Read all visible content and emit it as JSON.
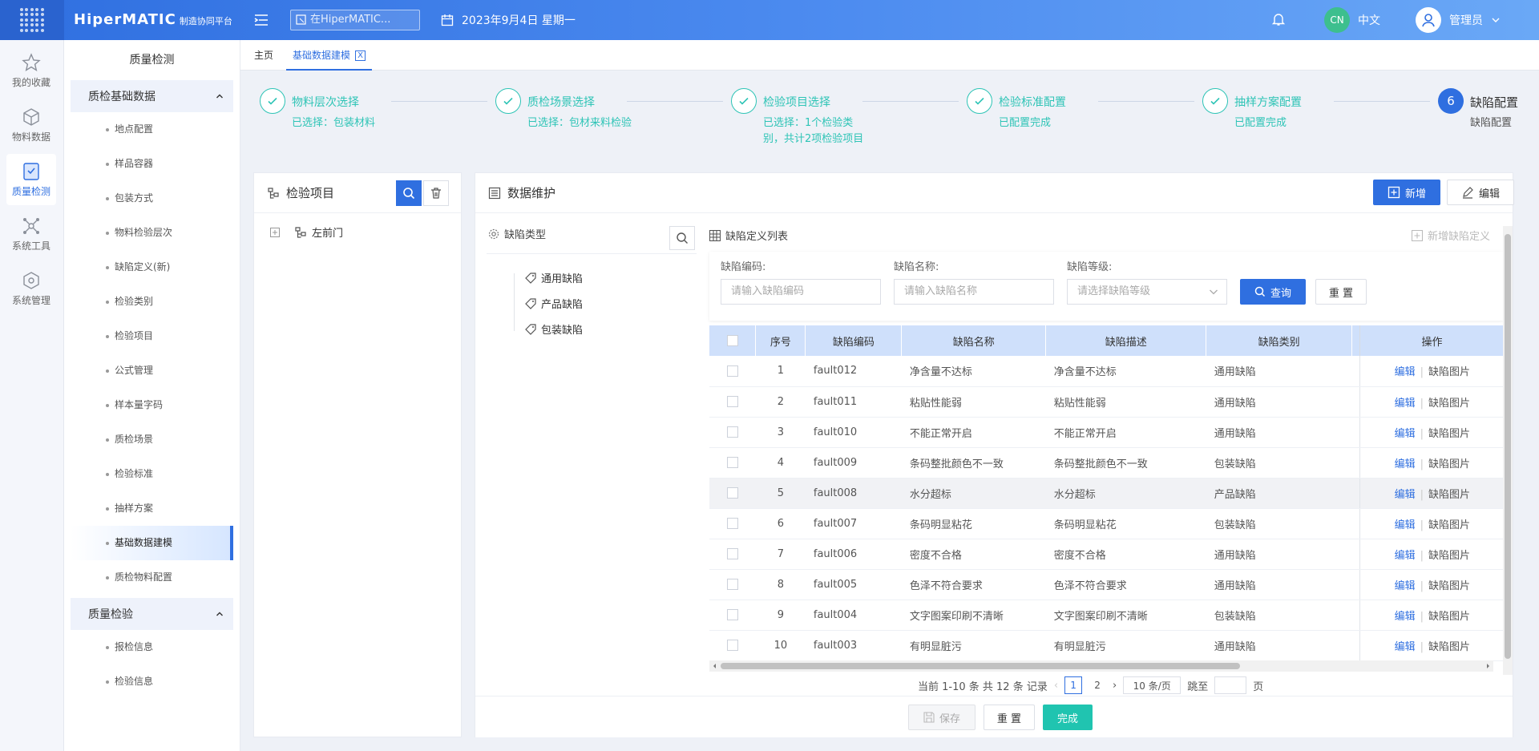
{
  "header": {
    "brand": "HiperMATIC",
    "brand_sub": "制造协同平台",
    "search_placeholder": "在HiperMATIC...",
    "date": "2023年9月4日 星期一",
    "lang_badge": "CN",
    "lang_label": "中文",
    "user_name": "管理员",
    "accent": "#2f6fe0"
  },
  "iconbar": {
    "items": [
      {
        "label": "我的收藏",
        "icon": "star-icon"
      },
      {
        "label": "物料数据",
        "icon": "cube-icon"
      },
      {
        "label": "质量检测",
        "icon": "shield-check-icon"
      },
      {
        "label": "系统工具",
        "icon": "network-icon"
      },
      {
        "label": "系统管理",
        "icon": "settings-cube-icon"
      }
    ]
  },
  "sidebar": {
    "title": "质量检测",
    "group1": "质检基础数据",
    "group1_items": [
      "地点配置",
      "样品容器",
      "包装方式",
      "物料检验层次",
      "缺陷定义(新)",
      "检验类别",
      "检验项目",
      "公式管理",
      "样本量字码",
      "质检场景",
      "检验标准",
      "抽样方案",
      "基础数据建模",
      "质检物料配置"
    ],
    "group2": "质量检验",
    "group2_items": [
      "报检信息",
      "检验信息"
    ]
  },
  "tabs": {
    "home": "主页",
    "active": "基础数据建模",
    "close": "X"
  },
  "steps": [
    {
      "title": "物料层次选择",
      "desc": "已选择：包装材料"
    },
    {
      "title": "质检场景选择",
      "desc": "已选择：包材来料检验"
    },
    {
      "title": "检验项目选择",
      "desc": "已选择：1个检验类别，共计2项检验项目"
    },
    {
      "title": "检验标准配置",
      "desc": "已配置完成"
    },
    {
      "title": "抽样方案配置",
      "desc": "已配置完成"
    },
    {
      "num": "6",
      "title": "缺陷配置",
      "desc": "缺陷配置"
    }
  ],
  "left_panel": {
    "title": "检验项目",
    "tree_node": "左前门"
  },
  "main_panel": {
    "title": "数据维护",
    "add_label": "新增",
    "edit_label": "编辑",
    "defect_type_title": "缺陷类型",
    "defect_types": [
      "通用缺陷",
      "产品缺陷",
      "包装缺陷"
    ],
    "list_title": "缺陷定义列表",
    "new_defect_label": "新增缺陷定义",
    "filters": {
      "code_label": "缺陷编码:",
      "code_placeholder": "请输入缺陷编码",
      "name_label": "缺陷名称:",
      "name_placeholder": "请输入缺陷名称",
      "level_label": "缺陷等级:",
      "level_placeholder": "请选择缺陷等级",
      "query_label": "查询",
      "reset_label": "重 置"
    },
    "columns": [
      "序号",
      "缺陷编码",
      "缺陷名称",
      "缺陷描述",
      "缺陷类别",
      "操作"
    ],
    "rows": [
      {
        "no": "1",
        "code": "fault012",
        "name": "净含量不达标",
        "desc": "净含量不达标",
        "cat": "通用缺陷"
      },
      {
        "no": "2",
        "code": "fault011",
        "name": "粘贴性能弱",
        "desc": "粘贴性能弱",
        "cat": "通用缺陷"
      },
      {
        "no": "3",
        "code": "fault010",
        "name": "不能正常开启",
        "desc": "不能正常开启",
        "cat": "通用缺陷"
      },
      {
        "no": "4",
        "code": "fault009",
        "name": "条码整批颜色不一致",
        "desc": "条码整批颜色不一致",
        "cat": "包装缺陷"
      },
      {
        "no": "5",
        "code": "fault008",
        "name": "水分超标",
        "desc": "水分超标",
        "cat": "产品缺陷"
      },
      {
        "no": "6",
        "code": "fault007",
        "name": "条码明显粘花",
        "desc": "条码明显粘花",
        "cat": "包装缺陷"
      },
      {
        "no": "7",
        "code": "fault006",
        "name": "密度不合格",
        "desc": "密度不合格",
        "cat": "通用缺陷"
      },
      {
        "no": "8",
        "code": "fault005",
        "name": "色泽不符合要求",
        "desc": "色泽不符合要求",
        "cat": "通用缺陷"
      },
      {
        "no": "9",
        "code": "fault004",
        "name": "文字图案印刷不清晰",
        "desc": "文字图案印刷不清晰",
        "cat": "包装缺陷"
      },
      {
        "no": "10",
        "code": "fault003",
        "name": "有明显脏污",
        "desc": "有明显脏污",
        "cat": "通用缺陷"
      }
    ],
    "op_edit": "编辑",
    "op_image": "缺陷图片",
    "pager": {
      "summary": "当前 1-10 条 共 12 条 记录",
      "pages": [
        "1",
        "2"
      ],
      "per_page": "10 条/页",
      "goto": "跳至",
      "page_unit": "页"
    }
  },
  "footer_actions": {
    "save": "保存",
    "reset": "重 置",
    "done": "完成"
  }
}
